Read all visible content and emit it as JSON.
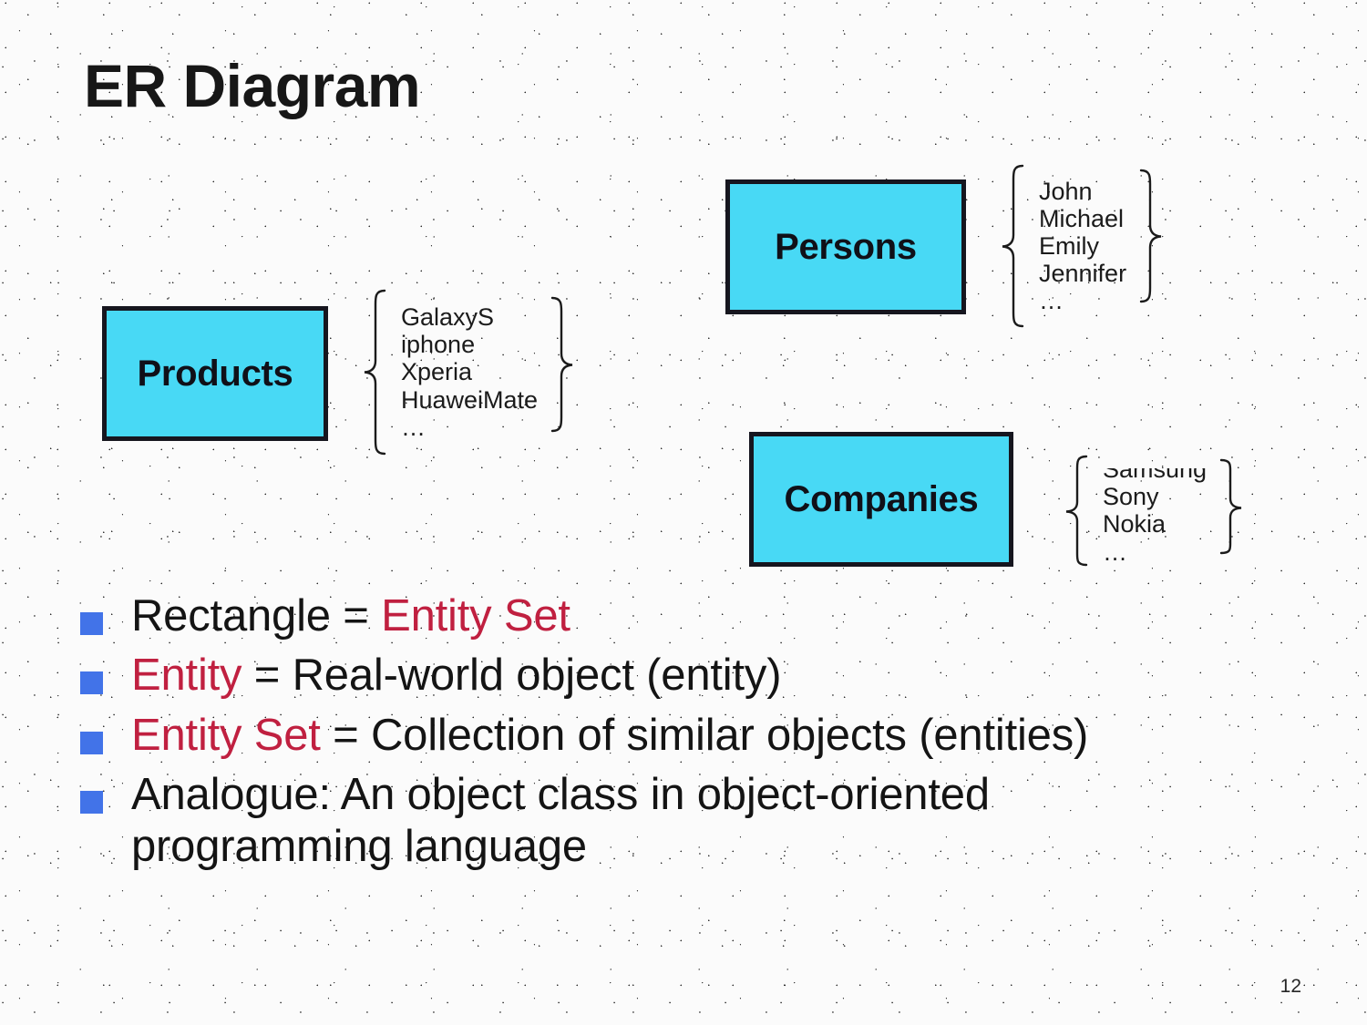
{
  "slide": {
    "title": "ER Diagram",
    "page_number": "12",
    "colors": {
      "entity_fill": "#48D9F5",
      "entity_border": "#16161f",
      "bullet_marker": "#4273E8",
      "highlight_text": "#C02040",
      "body_text": "#141414",
      "background": "#fbfbfb"
    }
  },
  "entities": [
    {
      "name": "Products",
      "members": [
        "GalaxyS",
        "iphone",
        "Xperia",
        "HuaweiMate",
        "…"
      ],
      "clipped_first_member": false
    },
    {
      "name": "Persons",
      "members": [
        "John",
        "Michael",
        "Emily",
        "Jennifer",
        "…"
      ],
      "clipped_first_member": false
    },
    {
      "name": "Companies",
      "members": [
        "Samsung",
        "Sony",
        "Nokia",
        "…"
      ],
      "clipped_first_member": true
    }
  ],
  "bullets": [
    {
      "parts": [
        {
          "text": "Rectangle = ",
          "highlight": false
        },
        {
          "text": "Entity Set",
          "highlight": true
        }
      ],
      "plain": "Rectangle = Entity Set"
    },
    {
      "parts": [
        {
          "text": "Entity",
          "highlight": true
        },
        {
          "text": " = Real-world object (entity)",
          "highlight": false
        }
      ],
      "plain": "Entity = Real-world object (entity)"
    },
    {
      "parts": [
        {
          "text": "Entity Set",
          "highlight": true
        },
        {
          "text": " = Collection of similar objects (entities)",
          "highlight": false
        }
      ],
      "plain": "Entity Set = Collection of similar objects (entities)"
    },
    {
      "parts": [
        {
          "text": "Analogue: An object class in object-oriented programming language",
          "highlight": false
        }
      ],
      "plain": "Analogue: An object class in object-oriented programming language"
    }
  ],
  "bullet_lines": {
    "b1_seg1": "Rectangle = ",
    "b1_seg2": "Entity Set",
    "b2_seg1": "Entity",
    "b2_seg2": " = Real-world object (entity)",
    "b3_seg1": "Entity Set",
    "b3_seg2": " = Collection of similar objects (entities)",
    "b4_seg1": "Analogue: An object class in object-oriented programming language"
  }
}
